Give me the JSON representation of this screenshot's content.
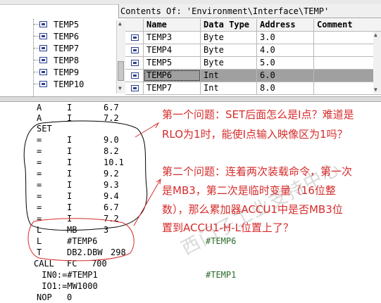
{
  "header": {
    "contents_label": "Contents Of: 'Environment\\Interface\\TEMP'"
  },
  "tree": {
    "items": [
      "TEMP5",
      "TEMP6",
      "TEMP7",
      "TEMP8",
      "TEMP9",
      "TEMP10"
    ]
  },
  "grid": {
    "columns": [
      "Name",
      "Data Type",
      "Address",
      "Comment"
    ],
    "rows": [
      {
        "name": "TEMP3",
        "type": "Byte",
        "address": "3.0",
        "comment": ""
      },
      {
        "name": "TEMP4",
        "type": "Byte",
        "address": "4.0",
        "comment": ""
      },
      {
        "name": "TEMP5",
        "type": "Byte",
        "address": "5.0",
        "comment": ""
      },
      {
        "name": "TEMP6",
        "type": "Int",
        "address": "6.0",
        "comment": ""
      },
      {
        "name": "TEMP7",
        "type": "Int",
        "address": "8.0",
        "comment": ""
      }
    ]
  },
  "code": {
    "lines": [
      {
        "op": "A",
        "operand": "I",
        "value": "6.7",
        "comment": ""
      },
      {
        "op": "A",
        "operand": "I",
        "value": "7.2",
        "comment": ""
      },
      {
        "op": "SET",
        "operand": "",
        "value": "",
        "comment": ""
      },
      {
        "op": "=",
        "operand": "I",
        "value": "9.0",
        "comment": ""
      },
      {
        "op": "=",
        "operand": "I",
        "value": "8.2",
        "comment": ""
      },
      {
        "op": "=",
        "operand": "I",
        "value": "10.1",
        "comment": ""
      },
      {
        "op": "=",
        "operand": "I",
        "value": "9.2",
        "comment": ""
      },
      {
        "op": "=",
        "operand": "I",
        "value": "9.3",
        "comment": ""
      },
      {
        "op": "=",
        "operand": "I",
        "value": "9.4",
        "comment": ""
      },
      {
        "op": "=",
        "operand": "I",
        "value": "6.7",
        "comment": ""
      },
      {
        "op": "=",
        "operand": "I",
        "value": "7.2",
        "comment": ""
      },
      {
        "op": "L",
        "operand": "MB",
        "value": "3",
        "comment": ""
      },
      {
        "op": "L",
        "operand": "#TEMP6",
        "value": "",
        "comment": "#TEMP6"
      },
      {
        "op": "T",
        "operand": "DB2.DBW",
        "value": "298",
        "comment": ""
      },
      {
        "op": "CALL",
        "operand": "FC",
        "value": "700",
        "comment": ""
      },
      {
        "op": " IN0:=#TEMP1",
        "operand": "",
        "value": "",
        "comment": "#TEMP1"
      },
      {
        "op": " IO1:=MW1000",
        "operand": "",
        "value": "",
        "comment": ""
      },
      {
        "op": "NOP",
        "operand": "0",
        "value": "",
        "comment": ""
      }
    ]
  },
  "annotations": {
    "q1_line1": "第一个问题：SET后面怎么是I点？难道是",
    "q1_line2": "RLO为1时，能使I点输入映像区为1吗？",
    "q2_line1": "第二个问题：连着两次装载命令，第一次",
    "q2_line2": "是MB3，第二次是临时变量（16位整",
    "q2_line3": "数），那么累加器ACCU1中是否MB3位",
    "q2_line4": "置到ACCU1-H-L位置上了？",
    "watermark": "西门子工业支持中心",
    "color": "#d62b2b"
  }
}
